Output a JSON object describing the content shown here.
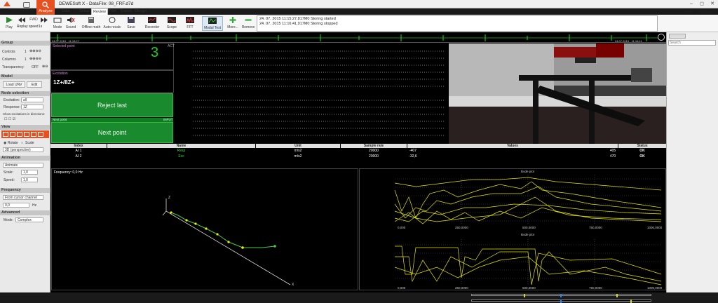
{
  "app": {
    "title": "DEWESoft X - DataFile: 08_FRF.d7d"
  },
  "nav": {
    "measure": "Measure",
    "analyze": "Analyze"
  },
  "tabs": [
    "Data files",
    "Setup",
    "Review",
    "Print",
    "Export",
    "Design"
  ],
  "ribbon": {
    "play": "Play",
    "replay_speed_label": "Replay speed",
    "fwd": "FWD",
    "speed_value": "1x",
    "mode": "Mode",
    "sound": "Sound",
    "offline_math": "Offline math",
    "auto_recalc": "Auto recalc",
    "save": "Save",
    "recorder": "Recorder",
    "scope": "Scope",
    "fft": "FFT",
    "modal_test": "Modal Test",
    "more": "More...",
    "remove": "Remove"
  },
  "log": [
    "24. 07. 2015 11:15:27,817M0 Storing started",
    "24. 07. 2015 11:16:41,917M0 Storing stopped"
  ],
  "right_ops": {
    "edit": "Edit",
    "options": "Options"
  },
  "timeline": {
    "start": "24.07.2015 · 11:15:27",
    "end": "24.07.2015 · 11:16:41"
  },
  "left": {
    "group_header": "Group",
    "controls_label": "Controls",
    "controls_val": "1",
    "columns_label": "Columns",
    "columns_val": "1",
    "transparency_label": "Transparency:",
    "transparency_val": "OFF",
    "model_header": "Model",
    "load_unv": "Load UNV",
    "edit": "Edit",
    "node_sel_header": "Node selection",
    "excitation_label": "Excitation:",
    "excitation_val": "all",
    "response_label": "Response:",
    "response_val": "1Z",
    "show_exc": "Show excitations in directions:",
    "view_header": "View",
    "rotate": "Rotate",
    "scale": "Scale",
    "perspective": "3D (perspective)",
    "animation_header": "Animation",
    "animate": "Animate",
    "scale_label": "Scale:",
    "scale_val": "1,0",
    "speed_label": "Speed:",
    "speed_val": "1,0",
    "frequency_header": "Frequency",
    "from_cursor": "From cursor channel",
    "freq_val": "0,0",
    "hz": "Hz",
    "advanced_header": "Advanced",
    "mode_label": "Mode:",
    "mode_val": "Complex"
  },
  "search": {
    "placeholder": "Search"
  },
  "modal": {
    "selected_point_label": "Selected point",
    "act_label": "ACT",
    "point_number": "3",
    "excitation_label": "Excitation",
    "excitation_text": "1Z+/8Z+",
    "reject_last": "Reject last",
    "next_point_label": "Next point",
    "input_label": "INPUT",
    "next_point": "Next point"
  },
  "table": {
    "headers": [
      "Index",
      "Name",
      "Unit",
      "Sample rate",
      "Values",
      "Status"
    ],
    "rows": [
      {
        "index": "AI 1",
        "name": "Resp",
        "unit": "m/s2",
        "rate": "20000",
        "min": "-407",
        "max": "405",
        "status": "OK"
      },
      {
        "index": "AI 2",
        "name": "Exc",
        "unit": "m/s2",
        "rate": "20000",
        "min": "-32,6",
        "max": "470",
        "status": "OK"
      }
    ]
  },
  "geom": {
    "freq_label": "Frequency: 0,0 Hz",
    "z_axis": "Z",
    "x_axis": "X"
  },
  "bode_top": {
    "title": "Bode plot",
    "x_ticks": [
      "0,000",
      "250,0000",
      "500,0000",
      "750,0000",
      "1000,0000"
    ]
  },
  "bode_bottom": {
    "title": "Bode plot",
    "x_ticks": [
      "0,000",
      "250,0000",
      "500,0000",
      "750,0000",
      "1000,0000"
    ]
  },
  "colors": {
    "accent": "#e8501f",
    "green": "#1a8a2e",
    "trace": "#e6e600"
  }
}
